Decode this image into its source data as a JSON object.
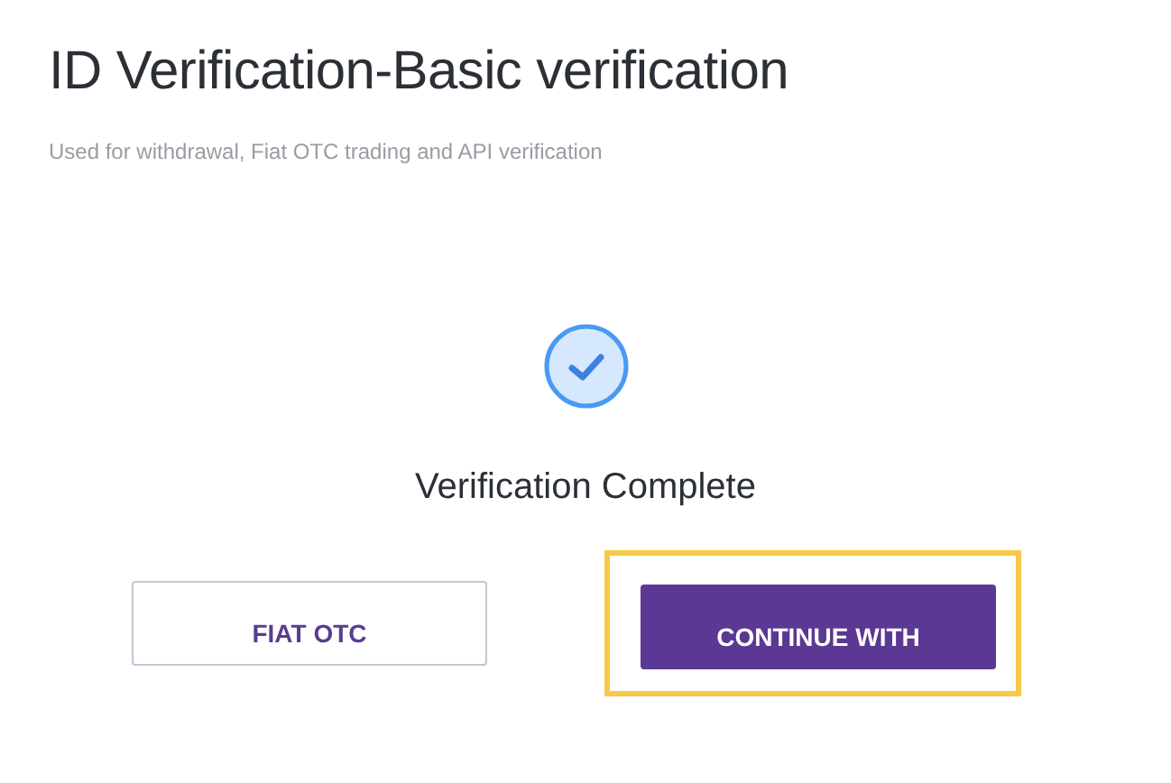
{
  "title": "ID Verification-Basic verification",
  "subtitle": "Used for withdrawal, Fiat OTC trading and API verification",
  "status": {
    "complete": true,
    "label": "Verification Complete"
  },
  "buttons": [
    {
      "label": "FIAT OTC",
      "kind": "outline",
      "highlighted": false
    },
    {
      "label": "CONTINUE WITH",
      "kind": "primary",
      "highlighted": true
    }
  ]
}
